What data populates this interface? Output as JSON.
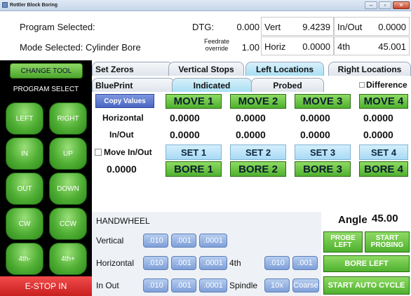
{
  "window": {
    "title": "Rottler Block Boring",
    "min": "–",
    "max": "▫",
    "close": "✕"
  },
  "info": {
    "program_label": "Program Selected:",
    "mode_label": "Mode Selected: Cylinder Bore",
    "dtg_label": "DTG:",
    "dtg_value": "0.000",
    "feedrate_label_1": "Feedrate",
    "feedrate_label_2": "override",
    "feedrate_value": "1.00",
    "vert_label": "Vert",
    "vert_value": "9.4239",
    "horiz_label": "Horiz",
    "horiz_value": "0.0000",
    "inout_label": "In/Out",
    "inout_value": "0.0000",
    "fourth_label": "4th",
    "fourth_value": "45.001"
  },
  "sidebar": {
    "change_tool": "CHANGE TOOL",
    "program_select": "PROGRAM SELECT",
    "left": "LEFT",
    "right": "RIGHT",
    "in": "IN",
    "up": "UP",
    "out": "OUT",
    "down": "DOWN",
    "cw": "CW",
    "ccw": "CCW",
    "fourth_minus": "4th-",
    "fourth_plus": "4th+",
    "estop": "E-STOP IN"
  },
  "tabs_top": [
    "Set Zeros",
    "Vertical Stops",
    "Left Locations",
    "Right Locations"
  ],
  "tabs_second": [
    "BluePrint",
    "Indicated",
    "Probed"
  ],
  "difference_label": "Difference",
  "grid": {
    "copy_values": "Copy Values",
    "moves": [
      "MOVE 1",
      "MOVE 2",
      "MOVE 3",
      "MOVE 4"
    ],
    "horizontal_label": "Horizontal",
    "horizontal_values": [
      "0.0000",
      "0.0000",
      "0.0000",
      "0.0000"
    ],
    "inout_label": "In/Out",
    "inout_values": [
      "0.0000",
      "0.0000",
      "0.0000",
      "0.0000"
    ],
    "move_inout_label": "Move In/Out",
    "sets": [
      "SET 1",
      "SET 2",
      "SET 3",
      "SET 4"
    ],
    "move_inout_value": "0.0000",
    "bores": [
      "BORE 1",
      "BORE 2",
      "BORE 3",
      "BORE 4"
    ]
  },
  "handwheel": {
    "title": "HANDWHEEL",
    "vertical": "Vertical",
    "horizontal": "Horizontal",
    "inout": "In Out",
    "fourth": "4th",
    "spindle": "Spindle",
    "incs": [
      ".010",
      ".001",
      ".0001"
    ],
    "fourth_incs": [
      ".010",
      ".001"
    ],
    "spindle_opts": [
      "10x",
      "Coarse"
    ]
  },
  "right_panel": {
    "angle_label": "Angle",
    "angle_value": "45.00",
    "probe_left": "PROBE LEFT",
    "start_probing": "START PROBING",
    "bore_left": "BORE LEFT",
    "start_auto": "START AUTO CYCLE"
  },
  "colors": {
    "green_button": "#4fb02e",
    "estop": "#e52d2d",
    "set_button": "#a9dbf6",
    "handwheel_button": "#7e9fd8"
  }
}
